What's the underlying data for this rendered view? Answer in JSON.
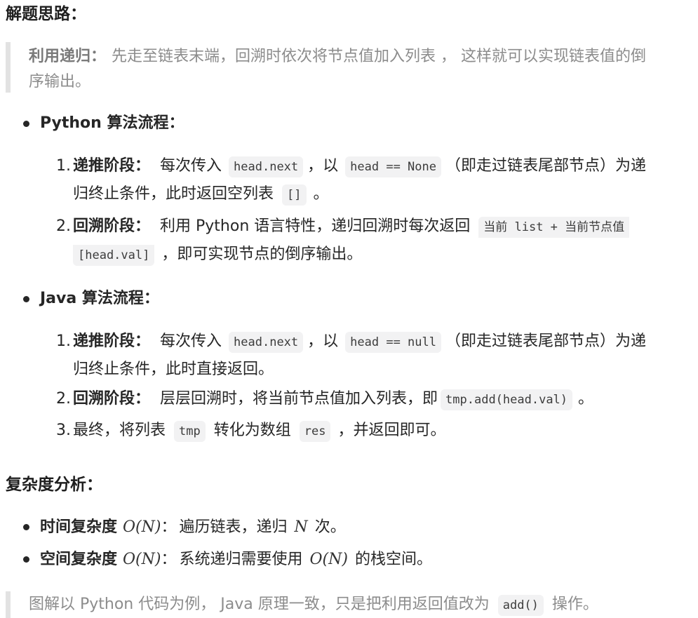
{
  "section1_title": "解题思路：",
  "intro": {
    "bold": "利用递归：",
    "line1": "先走至链表末端，回溯时依次将节点值加入列表 ， 这样就可以实现链表值的倒",
    "line2": "序输出。"
  },
  "python": {
    "heading": "Python 算法流程：",
    "step1": {
      "num": "1.",
      "bold": "递推阶段：",
      "t1": "每次传入",
      "c1": "head.next",
      "t2": "，以",
      "c2": "head == None",
      "t3": "（即走过链表尾部节点）为递",
      "t4": "归终止条件，此时返回空列表",
      "c3": "[]",
      "t5": "。"
    },
    "step2": {
      "num": "2.",
      "bold": "回溯阶段：",
      "t1": "利用 Python 语言特性，递归回溯时每次返回",
      "c1a": "当前 list + 当前节点值",
      "c1b": "[head.val]",
      "t2": "，即可实现节点的倒序输出。"
    }
  },
  "java": {
    "heading": "Java 算法流程：",
    "step1": {
      "num": "1.",
      "bold": "递推阶段：",
      "t1": "每次传入",
      "c1": "head.next",
      "t2": "，以",
      "c2": "head == null",
      "t3": "（即走过链表尾部节点）为递",
      "t4": "归终止条件，此时直接返回。"
    },
    "step2": {
      "num": "2.",
      "bold": "回溯阶段：",
      "t1": "层层回溯时，将当前节点值加入列表，即",
      "c1": "tmp.add(head.val)",
      "t2": "。"
    },
    "step3": {
      "num": "3.",
      "t1": "最终，将列表",
      "c1": "tmp",
      "t2": "转化为数组",
      "c2": "res",
      "t3": "，并返回即可。"
    }
  },
  "section2_title": "复杂度分析：",
  "complexity": {
    "time_bold": "时间复杂度",
    "time_math": "O(N)",
    "time_colon": "：",
    "time_t1": "遍历链表，递归",
    "time_math2": "N",
    "time_t2": "次。",
    "space_bold": "空间复杂度",
    "space_math": "O(N)",
    "space_colon": "：",
    "space_t1": "系统递归需要使用",
    "space_math2": "O(N)",
    "space_t2": "的栈空间。"
  },
  "note": {
    "t1": "图解以 Python 代码为例， Java 原理一致，只是把利用返回值改为",
    "c1": "add()",
    "t2": "操作。"
  }
}
